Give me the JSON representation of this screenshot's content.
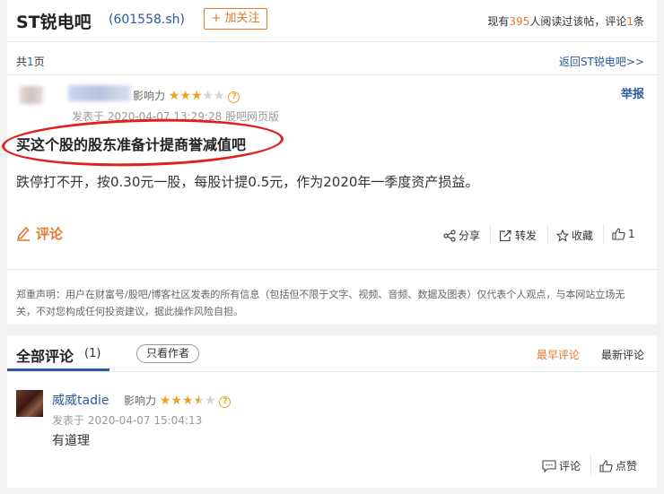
{
  "header": {
    "stock_name": "ST锐电吧",
    "stock_code": "(601558.sh)",
    "follow_label": "+ 加关注",
    "stats_prefix": "现有",
    "readers": "395",
    "stats_mid": "人阅读过该帖，评论",
    "comment_total": "1",
    "stats_suffix": "条"
  },
  "pager": {
    "prefix": "共",
    "pages": "1",
    "suffix": "页",
    "back_link": "返回ST锐电吧>>"
  },
  "post": {
    "influence_label": "影响力",
    "stars_full": "★★★",
    "stars_empty": "★★",
    "help_symbol": "?",
    "report": "举报",
    "meta": "发表于 2020-04-07 13:29:28 股吧网页版",
    "title": "买这个股的股东准备计提商誉减值吧",
    "body": "跌停打不开，按0.30元一股，每股计提0.5元，作为2020年一季度资产损益。",
    "comment_label": "评论",
    "share_label": "分享",
    "forward_label": "转发",
    "favorite_label": "收藏",
    "like_count": "1"
  },
  "disclaimer": "郑重声明：用户在财富号/股吧/博客社区发表的所有信息（包括但不限于文字、视频、音频、数据及图表）仅代表个人观点，与本网站立场无关，不对您构成任何投资建议，据此操作风险自担。",
  "comments_section": {
    "title": "全部评论",
    "count": "(1)",
    "author_only": "只看作者",
    "sort_earliest": "最早评论",
    "sort_newest": "最新评论",
    "items": [
      {
        "name": "威威tadie",
        "influence_label": "影响力",
        "stars_full": "★★★",
        "star_half": "★",
        "stars_empty": "★",
        "meta": "发表于 2020-04-07 15:04:13",
        "text": "有道理",
        "reply_label": "评论",
        "like_label": "点赞"
      }
    ]
  },
  "colors": {
    "accent": "#e4782f",
    "link": "#2b5a9e",
    "annotation": "#e0201e"
  }
}
